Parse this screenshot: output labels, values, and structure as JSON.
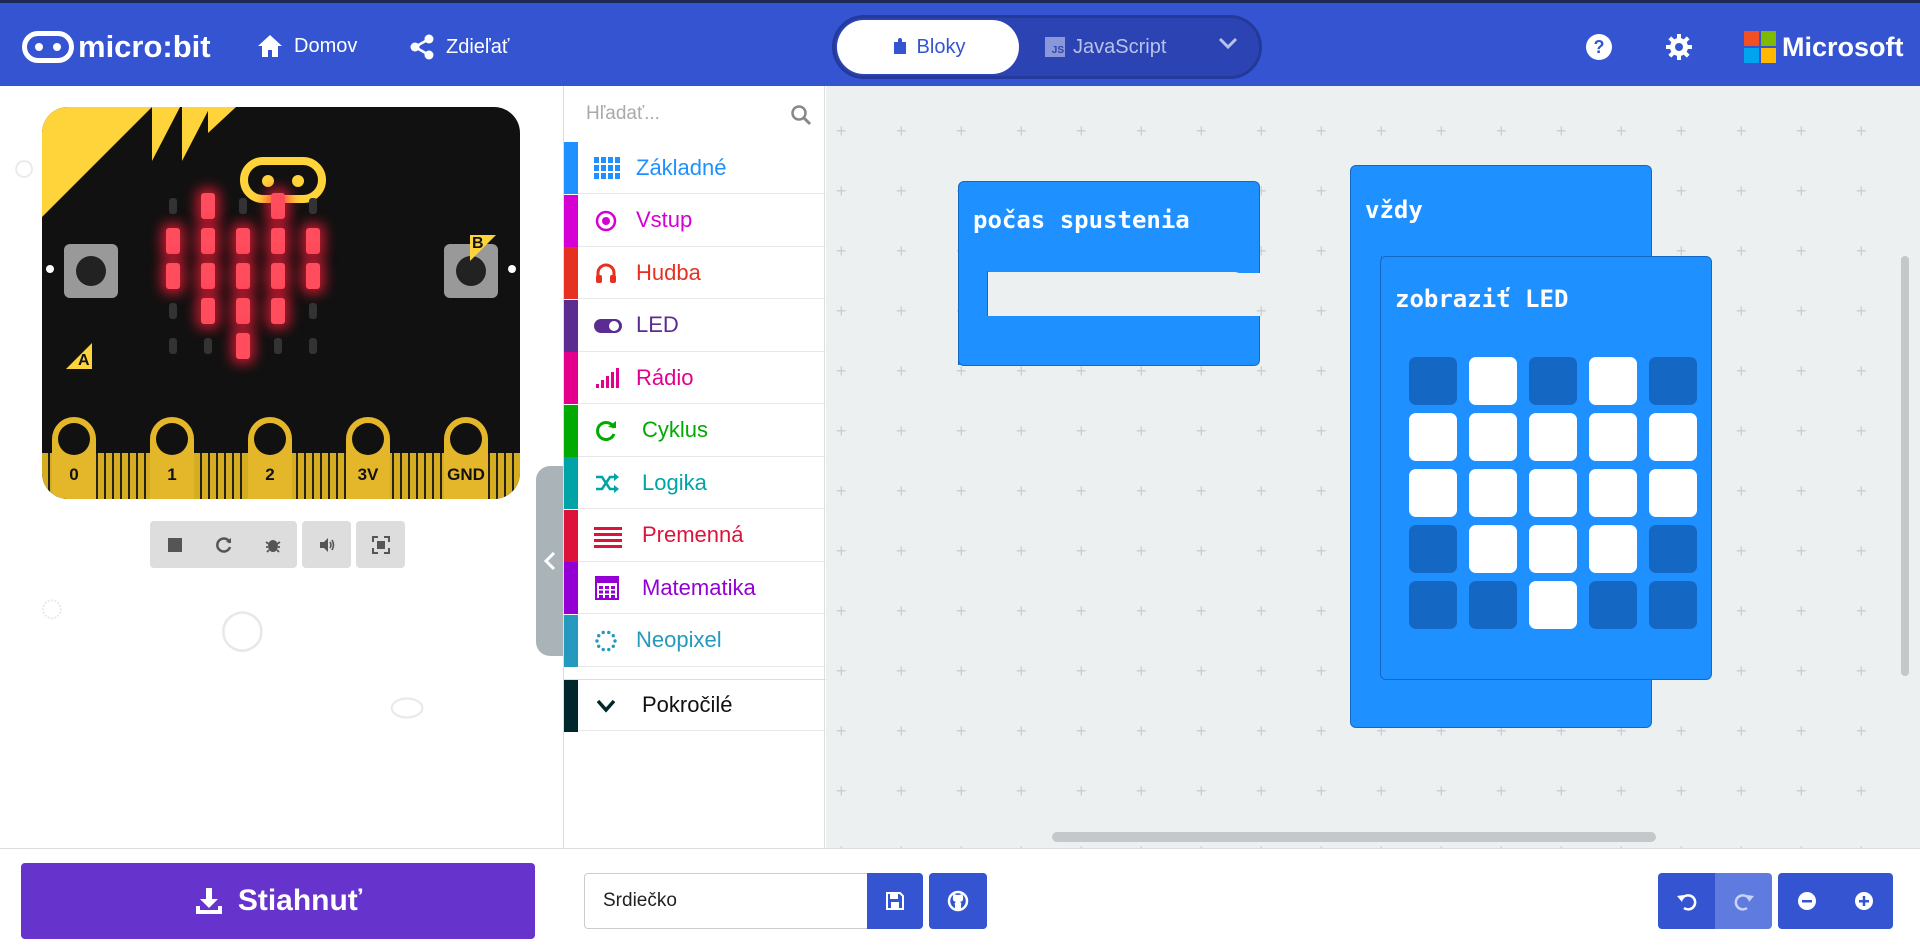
{
  "header": {
    "logo_text": "micro:bit",
    "home_label": "Domov",
    "share_label": "Zdieľať",
    "mode_blocks": "Bloky",
    "mode_js": "JavaScript",
    "js_badge": "JS",
    "brand": "Microsoft"
  },
  "simulator": {
    "pins": [
      "0",
      "1",
      "2",
      "3V",
      "GND"
    ],
    "button_a": "A",
    "button_b": "B",
    "led_matrix": [
      [
        0,
        1,
        0,
        1,
        0
      ],
      [
        1,
        1,
        1,
        1,
        1
      ],
      [
        1,
        1,
        1,
        1,
        1
      ],
      [
        0,
        1,
        1,
        1,
        0
      ],
      [
        0,
        0,
        1,
        0,
        0
      ]
    ]
  },
  "toolbox": {
    "search_placeholder": "Hľadať...",
    "categories": [
      {
        "label": "Základné",
        "color": "#1e90ff",
        "icon": "grid-icon"
      },
      {
        "label": "Vstup",
        "color": "#d400d4",
        "icon": "target-icon"
      },
      {
        "label": "Hudba",
        "color": "#e63022",
        "icon": "headphones-icon"
      },
      {
        "label": "LED",
        "color": "#5c2d91",
        "icon": "toggle-icon"
      },
      {
        "label": "Rádio",
        "color": "#e3008c",
        "icon": "signal-icon"
      },
      {
        "label": "Cyklus",
        "color": "#00aa00",
        "icon": "refresh-icon"
      },
      {
        "label": "Logika",
        "color": "#00a4a6",
        "icon": "shuffle-icon"
      },
      {
        "label": "Premenná",
        "color": "#dc143c",
        "icon": "lines-icon"
      },
      {
        "label": "Matematika",
        "color": "#9400d3",
        "icon": "calculator-icon"
      },
      {
        "label": "Neopixel",
        "color": "#2699bf",
        "icon": "dots-circle-icon"
      },
      {
        "label": "Pokročilé",
        "color": "#00272b",
        "icon": "chevron-down-icon"
      }
    ]
  },
  "workspace": {
    "on_start_label": "počas spustenia",
    "forever_label": "vždy",
    "show_leds_label": "zobraziť LED",
    "show_leds_matrix": [
      [
        0,
        1,
        0,
        1,
        0
      ],
      [
        1,
        1,
        1,
        1,
        1
      ],
      [
        1,
        1,
        1,
        1,
        1
      ],
      [
        0,
        1,
        1,
        1,
        0
      ],
      [
        0,
        0,
        1,
        0,
        0
      ]
    ]
  },
  "bottom": {
    "download_label": "Stiahnuť",
    "project_name": "Srdiečko"
  },
  "colors": {
    "header": "#3454d1",
    "download": "#6633cc",
    "block": "#1e90ff"
  }
}
